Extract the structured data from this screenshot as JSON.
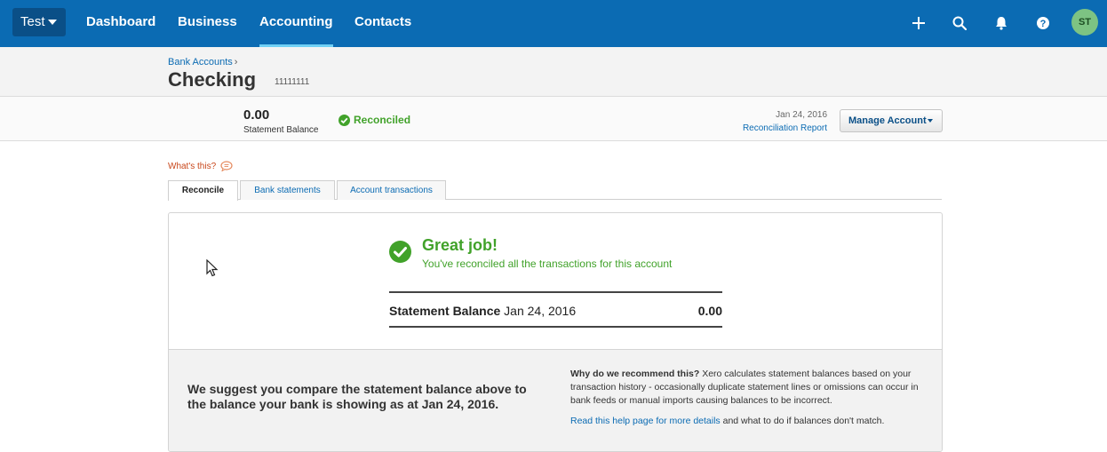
{
  "nav": {
    "org": "Test",
    "items": [
      "Dashboard",
      "Business",
      "Accounting",
      "Contacts"
    ],
    "active": "Accounting",
    "icons": [
      "plus-icon",
      "search-icon",
      "bell-icon",
      "help-icon"
    ],
    "avatar": "ST"
  },
  "header": {
    "breadcrumb": "Bank Accounts",
    "breadcrumb_sep": "›",
    "title": "Checking",
    "account_number": "11111111"
  },
  "balance": {
    "value": "0.00",
    "label": "Statement Balance",
    "status": "Reconciled",
    "date": "Jan 24, 2016",
    "report_link": "Reconciliation Report",
    "manage_button": "Manage Account"
  },
  "help": {
    "whats_this": "What's this?"
  },
  "tabs": [
    "Reconcile",
    "Bank statements",
    "Account transactions"
  ],
  "panel": {
    "title": "Great job!",
    "subtitle": "You've reconciled all the transactions for this account",
    "stmt_label": "Statement Balance",
    "stmt_date": "Jan 24, 2016",
    "stmt_value": "0.00",
    "suggest": "We suggest you compare the statement balance above to the balance your bank is showing as at Jan 24, 2016.",
    "why_bold": "Why do we recommend this?",
    "why_text": "Xero calculates statement balances based on your transaction history - occasionally duplicate statement lines or omissions can occur in bank feeds or manual imports causing balances to be incorrect.",
    "help_link": "Read this help page for more details",
    "help_rest": "and what to do if balances don't match."
  },
  "colors": {
    "nav": "#0b6bb3",
    "success": "#41a22a",
    "link": "#0b6bb3"
  }
}
